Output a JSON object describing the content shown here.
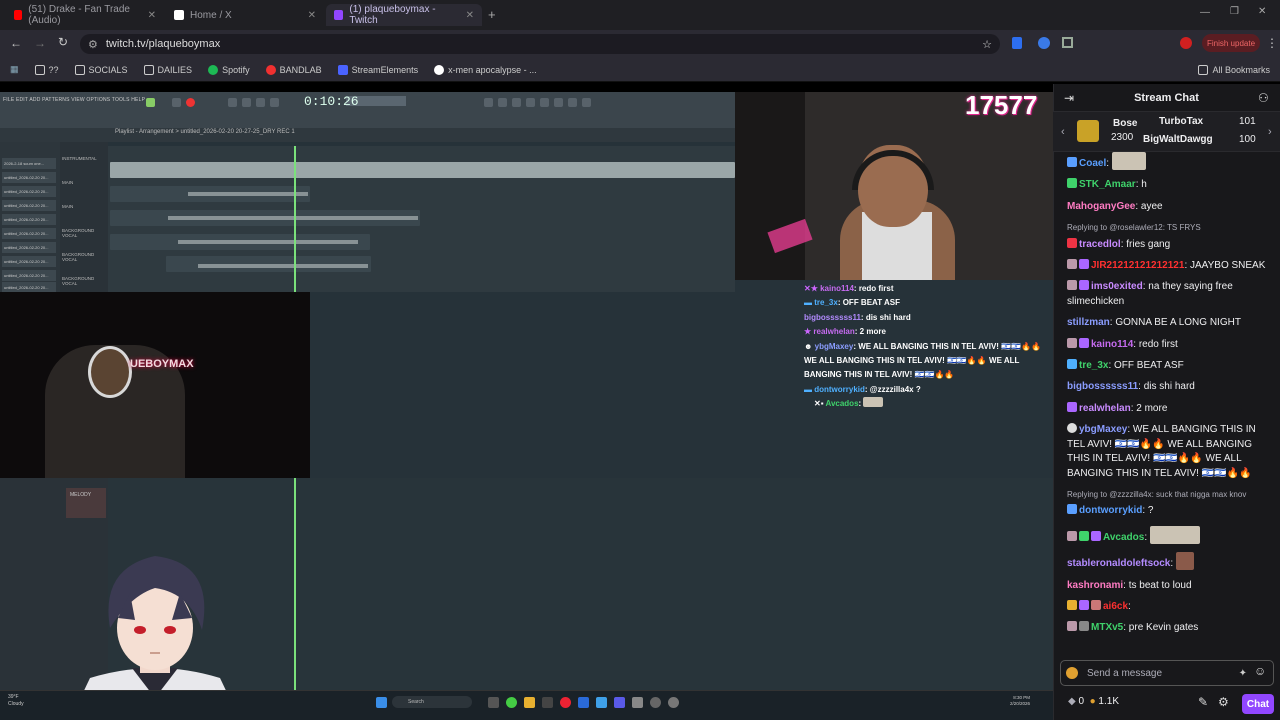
{
  "tabs": [
    {
      "label": "(51) Drake - Fan Trade (Audio)",
      "color": "#ff0000",
      "active": false
    },
    {
      "label": "Home / X",
      "color": "#ffffff",
      "active": false
    },
    {
      "label": "(1) plaqueboymax - Twitch",
      "color": "#9146ff",
      "active": true
    }
  ],
  "url": "twitch.tv/plaqueboymax",
  "finish_update": "Finish update",
  "bookmarks": [
    "??",
    "SOCIALS",
    "DAILIES",
    "Spotify",
    "BANDLAB",
    "StreamElements",
    "x-men apocalypse - ..."
  ],
  "all_bookmarks": "All Bookmarks",
  "daw": {
    "menu": "FILE EDIT ADD PATTERNS VIEW OPTIONS TOOLS HELP",
    "timer": "0:10:26",
    "playlist_title": "Playlist - Arrangement > untitled_2026-02-20 20-27-25_DRY REC 1",
    "tracks": [
      "2026-2-18 scum one...",
      "untitled_2026-02-20 20...",
      "untitled_2026-02-20 20...",
      "untitled_2026-02-20 20...",
      "untitled_2026-02-20 20...",
      "untitled_2026-02-20 20...",
      "untitled_2026-02-20 20...",
      "untitled_2026-02-20 20...",
      "untitled_2026-02-20 20...",
      "untitled_2026-02-20 20..."
    ],
    "headers": [
      "INSTRUMENTAL",
      "MAIN",
      "MAIN",
      "BACKGROUND VOCAL",
      "BACKGROUND VOCAL",
      "BACKGROUND VOCAL"
    ],
    "melody": "MELODY"
  },
  "cam2_sign": "UEBOYMAX",
  "viewer_counter": "17577",
  "overlay_chat": [
    {
      "user": "kaino114",
      "color": "#c66bf0",
      "text": "redo first"
    },
    {
      "user": "tre_3x",
      "color": "#4fb0ff",
      "text": "OFF BEAT ASF"
    },
    {
      "user": "bigbossssss11",
      "color": "#b38bff",
      "text": "dis shi hard"
    },
    {
      "user": "realwhelan",
      "color": "#c66bf0",
      "text": "2 more"
    },
    {
      "user": "ybgMaxey",
      "color": "#8b9dff",
      "text": "WE ALL BANGING THIS IN TEL AVIV! 🇮🇱🇮🇱🔥🔥 WE ALL BANGING THIS IN TEL AVIV! 🇮🇱🇮🇱🔥🔥 WE ALL BANGING THIS IN TEL AVIV! 🇮🇱🇮🇱🔥🔥"
    },
    {
      "user": "dontworrykid",
      "color": "#4fb0ff",
      "text": "@zzzzilla4x ?"
    },
    {
      "user": "Avcados",
      "color": "#3fd26b",
      "text": ""
    }
  ],
  "weather": {
    "temp": "39°F",
    "desc": "Cloudy"
  },
  "taskbar_search": "Search",
  "clock": {
    "time": "8:30 PM",
    "date": "2/20/2026"
  },
  "chat": {
    "title": "Stream Chat",
    "gifters": [
      {
        "name": "Bose",
        "value": "2300"
      },
      {
        "name": "TurboTax",
        "value": "101"
      },
      {
        "name": "BigWaltDawgg",
        "value": "100"
      }
    ],
    "messages": [
      {
        "user": "Coael",
        "color": "#5a9fff",
        "text": "",
        "emote": true
      },
      {
        "user": "STK_Amaar",
        "color": "#3fd26b",
        "text": "h"
      },
      {
        "user": "MahoganyGee",
        "color": "#ff7cc3",
        "text": "ayee"
      },
      {
        "reply": "Replying to @roselawler12: TS FRYS"
      },
      {
        "user": "tracedlol",
        "color": "#c98bff",
        "text": "fries gang"
      },
      {
        "user": "JIR21212121212121",
        "color": "#ff3030",
        "text": "JAAYBO SNEAK"
      },
      {
        "user": "ims0exited",
        "color": "#c98bff",
        "text": "na they saying free slimechicken"
      },
      {
        "user": "stillzman",
        "color": "#8b9dff",
        "text": "GONNA BE A LONG NIGHT"
      },
      {
        "user": "kaino114",
        "color": "#c66bf0",
        "text": "redo first"
      },
      {
        "user": "tre_3x",
        "color": "#3fd26b",
        "text": "OFF BEAT ASF"
      },
      {
        "user": "bigbossssss11",
        "color": "#8b9dff",
        "text": "dis shi hard"
      },
      {
        "user": "realwhelan",
        "color": "#c98bff",
        "text": "2 more"
      },
      {
        "user": "ybgMaxey",
        "color": "#8b9dff",
        "text": "WE ALL BANGING THIS IN TEL AVIV! 🇮🇱🇮🇱🔥🔥 WE ALL BANGING THIS IN TEL AVIV! 🇮🇱🇮🇱🔥🔥 WE ALL BANGING THIS IN TEL AVIV! 🇮🇱🇮🇱🔥🔥"
      },
      {
        "reply": "Replying to @zzzzilla4x: suck that nigga max knov"
      },
      {
        "user": "dontworrykid",
        "color": "#5a9fff",
        "text": "?"
      },
      {
        "user": "Avcados",
        "color": "#3fd26b",
        "text": "",
        "emote": true
      },
      {
        "user": "stableronaldoleftsock",
        "color": "#b38bff",
        "text": "",
        "emote": true
      },
      {
        "user": "kashronami",
        "color": "#ff7cc3",
        "text": "ts beat to loud"
      },
      {
        "user": "ai6ck",
        "color": "#ff3030",
        "text": ""
      },
      {
        "user": "MTXv5",
        "color": "#3fd26b",
        "text": "pre Kevin gates"
      }
    ],
    "send_placeholder": "Send a message",
    "points_a": "0",
    "points_b": "1.1K",
    "chat_button": "Chat"
  }
}
